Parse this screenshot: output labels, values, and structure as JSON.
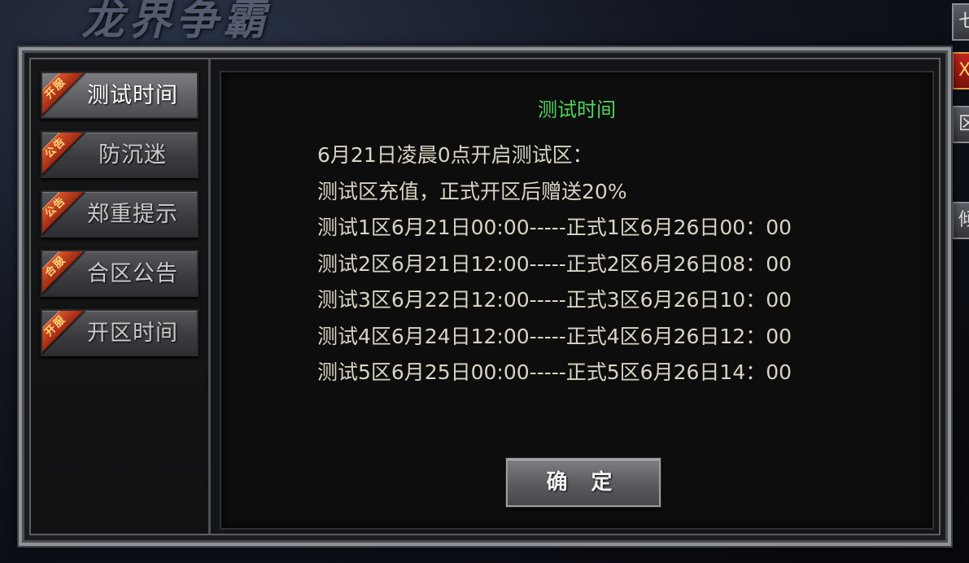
{
  "background": {
    "game_logo_text": "龙界争霸"
  },
  "side_buttons": [
    "七",
    "X",
    "区",
    "倾"
  ],
  "sidebar": {
    "tabs": [
      {
        "badge": "开服",
        "label": "测试时间",
        "active": true
      },
      {
        "badge": "公告",
        "label": "防沉迷",
        "active": false
      },
      {
        "badge": "公告",
        "label": "郑重提示",
        "active": false
      },
      {
        "badge": "合服",
        "label": "合区公告",
        "active": false
      },
      {
        "badge": "开服",
        "label": "开区时间",
        "active": false
      }
    ]
  },
  "content": {
    "title": "测试时间",
    "title_color": "#4fd65b",
    "lines": [
      "6月21日凌晨0点开启测试区：",
      "测试区充值，正式开区后赠送20%",
      "测试1区6月21日00:00-----正式1区6月26日00：00",
      "测试2区6月21日12:00-----正式2区6月26日08：00",
      "测试3区6月22日12:00-----正式3区6月26日10：00",
      "测试4区6月24日12:00-----正式4区6月26日12：00",
      "测试5区6月25日00:00-----正式5区6月26日14：00"
    ],
    "confirm_label": "确 定"
  }
}
